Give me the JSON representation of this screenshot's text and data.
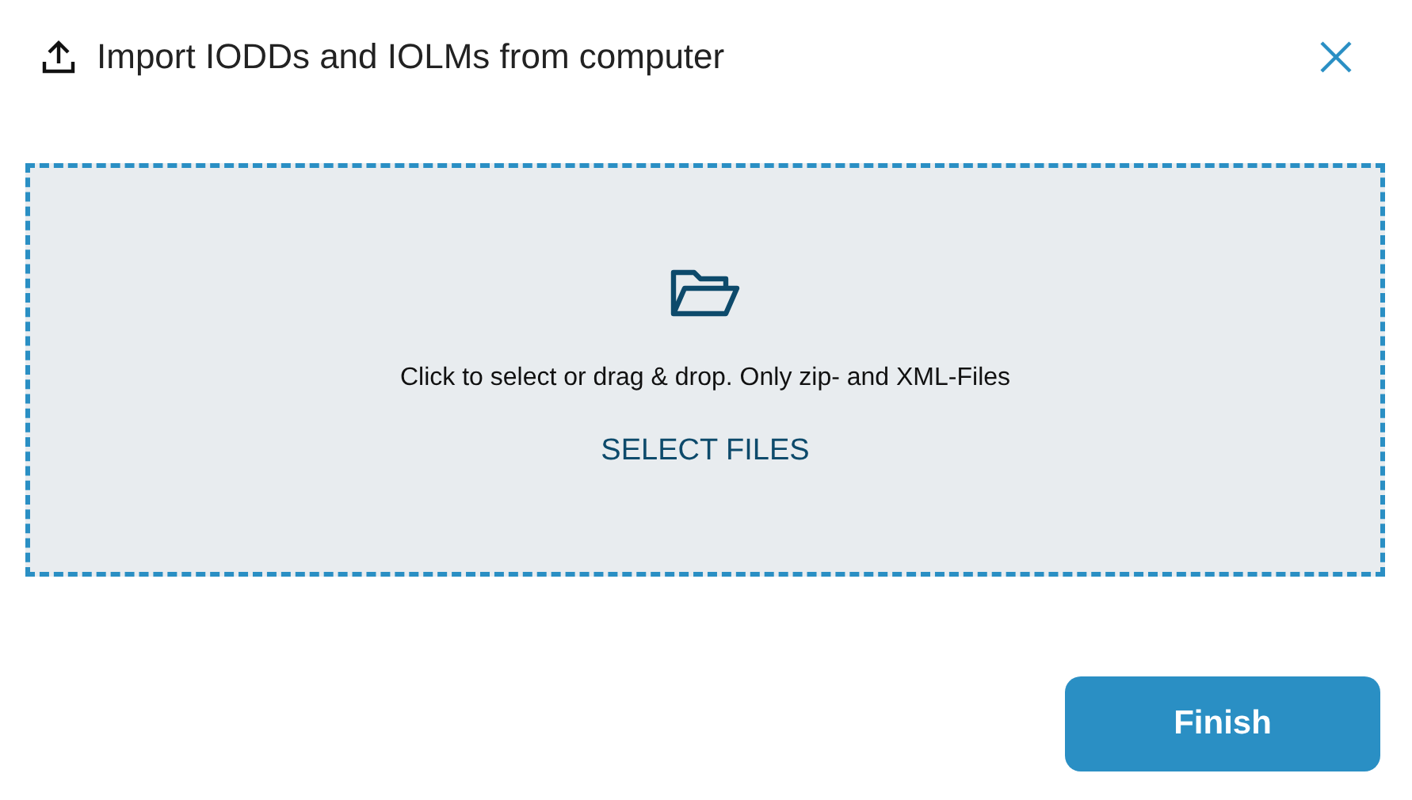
{
  "dialog": {
    "title": "Import IODDs and IOLMs from computer"
  },
  "dropzone": {
    "instruction": "Click to select or drag & drop. Only zip- and XML-Files",
    "select_button": "SELECT FILES"
  },
  "buttons": [
    {
      "label": "Finish"
    }
  ]
}
